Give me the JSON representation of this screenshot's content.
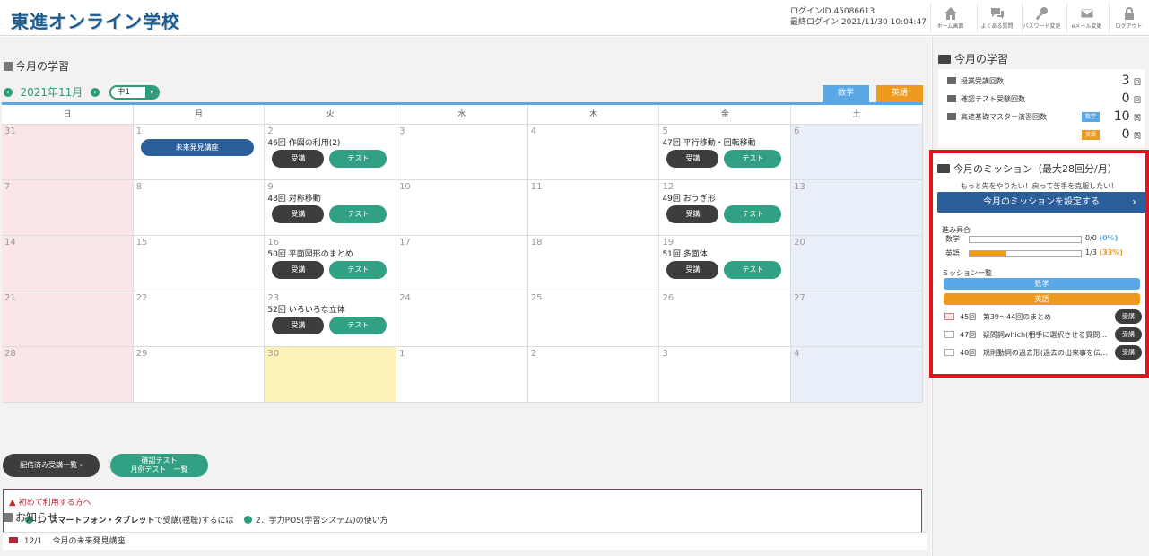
{
  "header": {
    "logo": "東進オンライン学校",
    "login_id": "ログインID 45086613",
    "last_login": "最終ログイン 2021/11/30 10:04:47",
    "nav": [
      {
        "label": "ホーム画面",
        "icon": "home-icon"
      },
      {
        "label": "よくある質問",
        "icon": "chat-icon"
      },
      {
        "label": "パスワード変更",
        "icon": "key-icon"
      },
      {
        "label": "eメール変更",
        "icon": "mail-icon"
      },
      {
        "label": "ログアウト",
        "icon": "lock-icon"
      }
    ]
  },
  "calendar": {
    "section_title": "今月の学習",
    "month_label": "2021年11月",
    "grade_value": "中1",
    "tabs": {
      "math": "数学",
      "english": "英語"
    },
    "weekdays": [
      "日",
      "月",
      "火",
      "水",
      "木",
      "金",
      "土"
    ],
    "weeks": [
      [
        {
          "d": "31"
        },
        {
          "d": "1",
          "special": "未来発見講座"
        },
        {
          "d": "2",
          "lesson": "46回 作図の利用(2)"
        },
        {
          "d": "3"
        },
        {
          "d": "4"
        },
        {
          "d": "5",
          "lesson": "47回 平行移動・回転移動"
        },
        {
          "d": "6"
        }
      ],
      [
        {
          "d": "7"
        },
        {
          "d": "8"
        },
        {
          "d": "9",
          "lesson": "48回 対称移動"
        },
        {
          "d": "10"
        },
        {
          "d": "11"
        },
        {
          "d": "12",
          "lesson": "49回 おうぎ形"
        },
        {
          "d": "13"
        }
      ],
      [
        {
          "d": "14"
        },
        {
          "d": "15"
        },
        {
          "d": "16",
          "lesson": "50回 平面図形のまとめ"
        },
        {
          "d": "17"
        },
        {
          "d": "18"
        },
        {
          "d": "19",
          "lesson": "51回 多面体"
        },
        {
          "d": "20"
        }
      ],
      [
        {
          "d": "21"
        },
        {
          "d": "22"
        },
        {
          "d": "23",
          "lesson": "52回 いろいろな立体"
        },
        {
          "d": "24"
        },
        {
          "d": "25"
        },
        {
          "d": "26"
        },
        {
          "d": "27"
        }
      ],
      [
        {
          "d": "28"
        },
        {
          "d": "29"
        },
        {
          "d": "30",
          "today": true
        },
        {
          "d": "1"
        },
        {
          "d": "2"
        },
        {
          "d": "3"
        },
        {
          "d": "4"
        }
      ]
    ],
    "attend_label": "受講",
    "test_label": "テスト"
  },
  "buttons": {
    "delivered_list": "配信済み受講一覧",
    "test_list_line1": "確認テスト",
    "test_list_line2": "月例テスト　一覧"
  },
  "first_time": {
    "title": "初めて利用する方へ",
    "link1_prefix": "1．",
    "link1_bold": "スマートフォン・タブレット",
    "link1_suffix": "で受講(視聴)するには",
    "link2": "2．学力POS(学習システム)の使い方"
  },
  "news": {
    "section_title": "お知らせ",
    "items": [
      {
        "date": "12/1",
        "title": "今月の未来発見講座"
      }
    ]
  },
  "sidebar": {
    "study_title": "今月の学習",
    "stats": [
      {
        "label": "授業受講回数",
        "value": "3",
        "unit": "回"
      },
      {
        "label": "確認テスト受験回数",
        "value": "0",
        "unit": "回"
      },
      {
        "label": "高速基礎マスター演習回数",
        "badge": "数学",
        "value": "10",
        "unit": "問"
      },
      {
        "badge": "英語",
        "value": "0",
        "unit": "問"
      }
    ]
  },
  "mission": {
    "title": "今月のミッション（最大28回分/月）",
    "subtitle": "もっと先をやりたい！戻って苦手を克服したい！",
    "set_button": "今月のミッションを設定する",
    "progress_label": "進み具合",
    "progress": [
      {
        "subject": "数学",
        "text": "0/0",
        "pct": "(0%)",
        "fraction": 0
      },
      {
        "subject": "英語",
        "text": "1/3",
        "pct": "(33%)",
        "fraction": 0.33
      }
    ],
    "list_label": "ミッション一覧",
    "math_bar": "数学",
    "english_bar": "英語",
    "items": [
      {
        "no": "45回",
        "title": "第39〜44回のまとめ",
        "btn": "受講"
      },
      {
        "no": "47回",
        "title": "疑問詞which(相手に選択させる質問…",
        "btn": "受講"
      },
      {
        "no": "48回",
        "title": "規則動詞の過去形(過去の出来事を伝…",
        "btn": "受講"
      }
    ],
    "colors": {
      "accent": "#e3121b",
      "math": "#5aa9e6",
      "english": "#ee9a1e"
    }
  }
}
